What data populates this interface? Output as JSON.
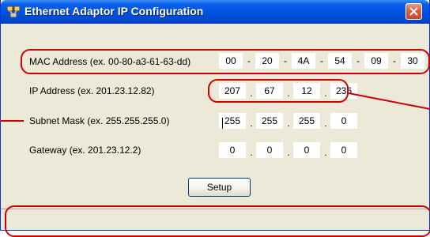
{
  "window": {
    "title": "Ethernet Adaptor IP Configuration"
  },
  "fields": {
    "mac": {
      "label": "MAC Address (ex. 00-80-a3-61-63-dd)",
      "octets": [
        "00",
        "20",
        "4A",
        "54",
        "09",
        "30"
      ],
      "separator": "-"
    },
    "ip": {
      "label": "IP Address (ex. 201.23.12.82)",
      "octets": [
        "207",
        "67",
        "12",
        "236"
      ],
      "separator": "."
    },
    "subnet": {
      "label": "Subnet Mask (ex. 255.255.255.0)",
      "octets": [
        "255",
        "255",
        "255",
        "0"
      ],
      "separator": "."
    },
    "gateway": {
      "label": "Gateway (ex. 201.23.12.2)",
      "octets": [
        "0",
        "0",
        "0",
        "0"
      ],
      "separator": "."
    }
  },
  "buttons": {
    "setup_label": "Setup"
  },
  "colors": {
    "highlight": "#d00000",
    "titlebar": "#0054e3",
    "window_bg": "#ece9d8"
  }
}
